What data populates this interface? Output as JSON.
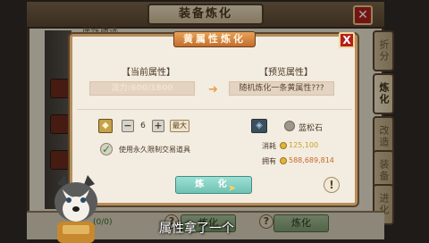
{
  "background_panel": {
    "title": "装备炼化",
    "filter_label": "属性筛选",
    "side_tabs": [
      "折分",
      "炼化",
      "改造",
      "装备",
      "进化"
    ],
    "active_tab": "炼化",
    "bottom_left_value": "(0/0)",
    "bottom_right_button": "炼化",
    "bottom_left_button": "炼化"
  },
  "dialog": {
    "title": "黄属性炼化",
    "current_label": "【当前属性】",
    "current_value": "法力:600/1800",
    "preview_label": "【预览属性】",
    "preview_value": "随机炼化一条黄属性???",
    "quantity": "6",
    "minus": "−",
    "plus": "+",
    "max_label": "最大",
    "use_bound_label": "使用永久限制交易道具",
    "material_name": "蓝松石",
    "cost_label": "消耗",
    "cost_value": "125,100",
    "owned_label": "拥有",
    "owned_value": "588,689,814",
    "refine_button": "炼 化",
    "info_button": "!",
    "close_button": "X"
  },
  "subtitle": "属性拿了一个",
  "colors": {
    "cost_value": "#c9a227",
    "owned_value": "#c46b28"
  }
}
